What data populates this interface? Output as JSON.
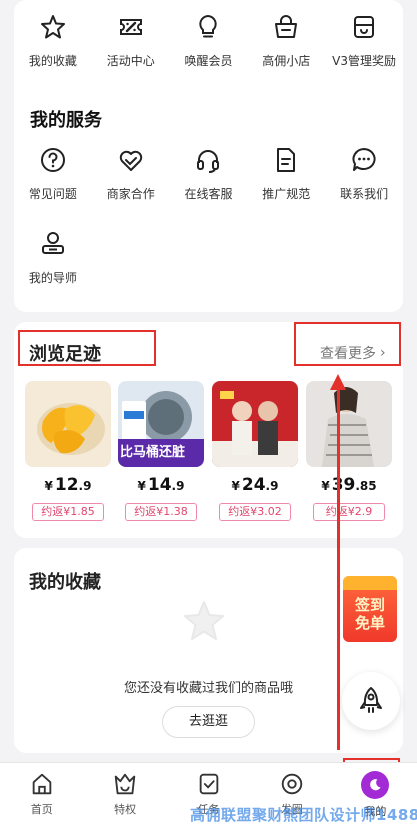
{
  "top_grid": {
    "items": [
      {
        "label": "我的收藏",
        "icon": "star-icon"
      },
      {
        "label": "活动中心",
        "icon": "coupon-icon"
      },
      {
        "label": "唤醒会员",
        "icon": "lightbulb-icon"
      },
      {
        "label": "高佣小店",
        "icon": "shop-basket-icon"
      },
      {
        "label": "V3管理奖励",
        "icon": "gift-box-icon"
      }
    ]
  },
  "services": {
    "title": "我的服务",
    "items": [
      {
        "label": "常见问题",
        "icon": "question-icon"
      },
      {
        "label": "商家合作",
        "icon": "handshake-heart-icon"
      },
      {
        "label": "在线客服",
        "icon": "headset-icon"
      },
      {
        "label": "推广规范",
        "icon": "document-icon"
      },
      {
        "label": "联系我们",
        "icon": "chat-icon"
      },
      {
        "label": "我的导师",
        "icon": "mentor-icon"
      }
    ]
  },
  "browse": {
    "title": "浏览足迹",
    "more_label": "查看更多",
    "products": [
      {
        "currency": "¥",
        "price_int": "12",
        "price_dec": ".9",
        "rebate": "约返¥1.85",
        "image_text": ""
      },
      {
        "currency": "¥",
        "price_int": "14",
        "price_dec": ".9",
        "rebate": "约返¥1.38",
        "image_text": "比马桶还脏"
      },
      {
        "currency": "¥",
        "price_int": "24",
        "price_dec": ".9",
        "rebate": "约返¥3.02",
        "image_text": ""
      },
      {
        "currency": "¥",
        "price_int": "39",
        "price_dec": ".85",
        "rebate": "约返¥2.9",
        "image_text": ""
      }
    ]
  },
  "favorites": {
    "title": "我的收藏",
    "empty_text": "您还没有收藏过我们的商品哦",
    "button_label": "去逛逛"
  },
  "floating": {
    "sign_label_1": "签到",
    "sign_label_2": "免单"
  },
  "tabbar": {
    "items": [
      {
        "label": "首页",
        "icon": "home-icon"
      },
      {
        "label": "特权",
        "icon": "crown-bag-icon"
      },
      {
        "label": "任务",
        "icon": "task-icon"
      },
      {
        "label": "发圈",
        "icon": "circle-icon"
      },
      {
        "label": "我的",
        "icon": "moon-icon"
      }
    ],
    "active_index": 4
  },
  "watermark": "高佣联盟聚财熊团队设计师1488",
  "colors": {
    "accent_red": "#e4302b",
    "rebate_pink": "#e0476f",
    "me_purple": "#a22bd6"
  }
}
